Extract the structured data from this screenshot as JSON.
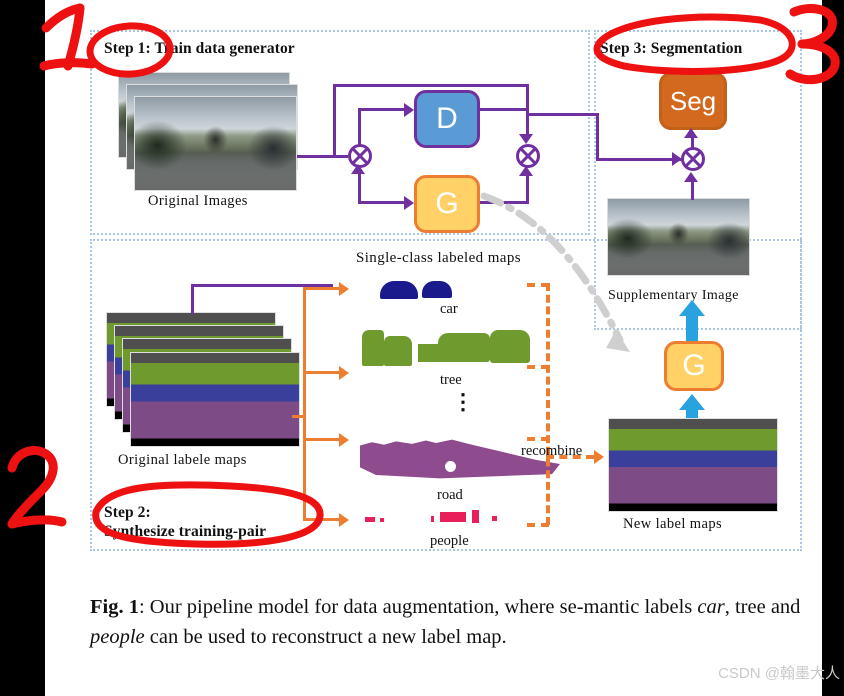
{
  "figure": {
    "panels": [
      {
        "id": "step1",
        "title": "Step 1: Train data generator"
      },
      {
        "id": "step2",
        "title_line1": "Step 2:",
        "title_line2": "Synthesize training-pair"
      },
      {
        "id": "step3",
        "title": "Step 3: Segmentation"
      }
    ],
    "boxes": {
      "discriminator": "D",
      "generator": "G",
      "generator_right": "G",
      "segmentation": "Seg"
    },
    "captions": {
      "original_images": "Original Images",
      "original_label_maps": "Original labele maps",
      "single_class_title": "Single-class  labeled  maps",
      "supplementary_image": "Supplementary Image",
      "new_label_maps": "New label maps",
      "recombine": "recombine"
    },
    "class_labels": [
      {
        "name": "car",
        "color": "#1a1a8c"
      },
      {
        "name": "tree",
        "color": "#6f9a2e"
      },
      {
        "name": "road",
        "color": "#8e4b8e"
      },
      {
        "name": "people",
        "color": "#e8205a"
      }
    ],
    "vertical_ellipsis": "⋮"
  },
  "caption": {
    "label": "Fig. 1",
    "text_1": ": Our pipeline model for data augmentation, where se-mantic labels ",
    "em_1": "car",
    "text_2": ", tree and ",
    "em_2": "people",
    "text_3": " can be used to reconstruct a new label map."
  },
  "annotations": {
    "marks": [
      "1",
      "2",
      "3"
    ],
    "color": "#ee1111",
    "circled": [
      "Step 1:",
      "Step 3: Segmentation",
      "Step 2: Synthesize training-pair"
    ]
  },
  "watermark": {
    "text": "CSDN @翰墨大人"
  },
  "colors": {
    "panel_border": "#a8c6e6",
    "wire_purple": "#7030a0",
    "wire_orange": "#ed7d31",
    "arrow_blue": "#29a3e0",
    "box_d": "#5b9bd5",
    "box_g": "#ffd166",
    "box_seg": "#d2691e",
    "annotation_red": "#ee1111",
    "page_background": "#ffffff",
    "letterbox": "#000000"
  }
}
